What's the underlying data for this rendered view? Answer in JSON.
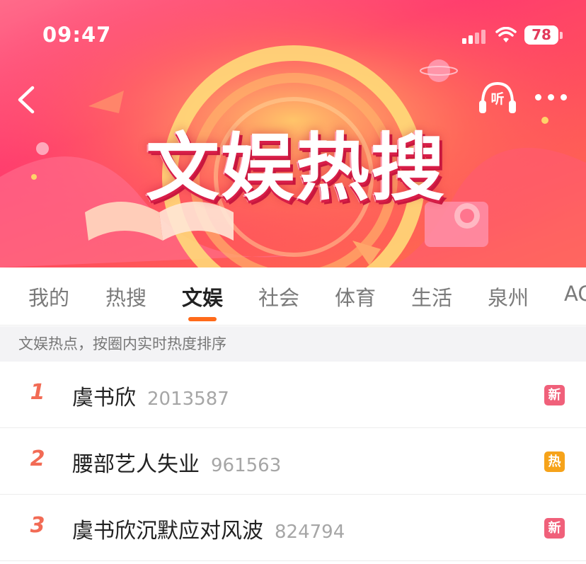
{
  "status_bar": {
    "time": "09:47",
    "battery": "78"
  },
  "header": {
    "title": "文娱热搜",
    "listen_label": "听"
  },
  "tabs": [
    {
      "label": "我的",
      "active": false
    },
    {
      "label": "热搜",
      "active": false
    },
    {
      "label": "文娱",
      "active": true
    },
    {
      "label": "社会",
      "active": false
    },
    {
      "label": "体育",
      "active": false
    },
    {
      "label": "生活",
      "active": false
    },
    {
      "label": "泉州",
      "active": false
    },
    {
      "label": "AC",
      "active": false
    }
  ],
  "info_strip": "文娱热点，按圈内实时热度排序",
  "list": [
    {
      "rank": "1",
      "title": "虞书欣",
      "count": "2013587",
      "badge": "新",
      "badge_color": "#f0607a"
    },
    {
      "rank": "2",
      "title": "腰部艺人失业",
      "count": "961563",
      "badge": "热",
      "badge_color": "#f6a31a"
    },
    {
      "rank": "3",
      "title": "虞书欣沉默应对风波",
      "count": "824794",
      "badge": "新",
      "badge_color": "#f0607a"
    }
  ],
  "colors": {
    "accent": "#ff6a1a",
    "rank": "#f26b55",
    "banner": "#ff3d6e"
  }
}
